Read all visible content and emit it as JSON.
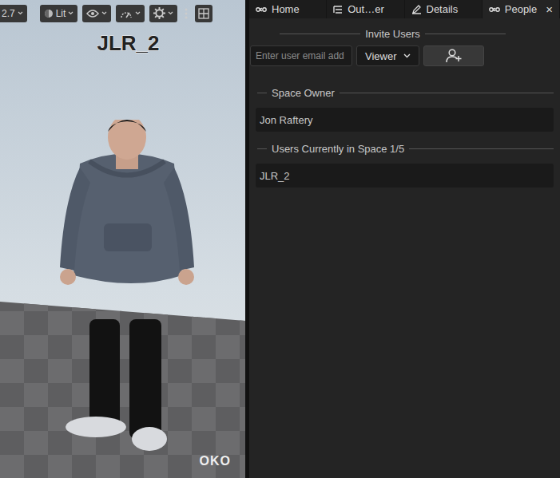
{
  "viewport": {
    "toolbar": [
      {
        "label": "2.7",
        "kind": "dropdown"
      },
      {
        "label": "Lit",
        "kind": "lit"
      },
      {
        "label": "",
        "kind": "eye"
      },
      {
        "label": "",
        "kind": "speed"
      },
      {
        "label": "",
        "kind": "gear"
      },
      {
        "label": "",
        "kind": "kebab"
      },
      {
        "label": "",
        "kind": "grid"
      }
    ],
    "nametag": "JLR_2",
    "logo": "OKO"
  },
  "tabs": [
    {
      "label": "Home",
      "icon": "oko",
      "selected": false,
      "closable": false,
      "close": ""
    },
    {
      "label": "Out…er",
      "icon": "list",
      "selected": false,
      "closable": false,
      "close": ""
    },
    {
      "label": "Details",
      "icon": "pencil",
      "selected": false,
      "closable": false,
      "close": ""
    },
    {
      "label": "People",
      "icon": "oko",
      "selected": true,
      "closable": true,
      "close": "×"
    }
  ],
  "invite": {
    "title": "Invite Users",
    "placeholder": "Enter user email add",
    "role": "Viewer"
  },
  "owner": {
    "title": "Space Owner",
    "name": "Jon Raftery"
  },
  "users": {
    "title": "Users Currently in Space 1/5",
    "items": [
      "JLR_2"
    ]
  }
}
